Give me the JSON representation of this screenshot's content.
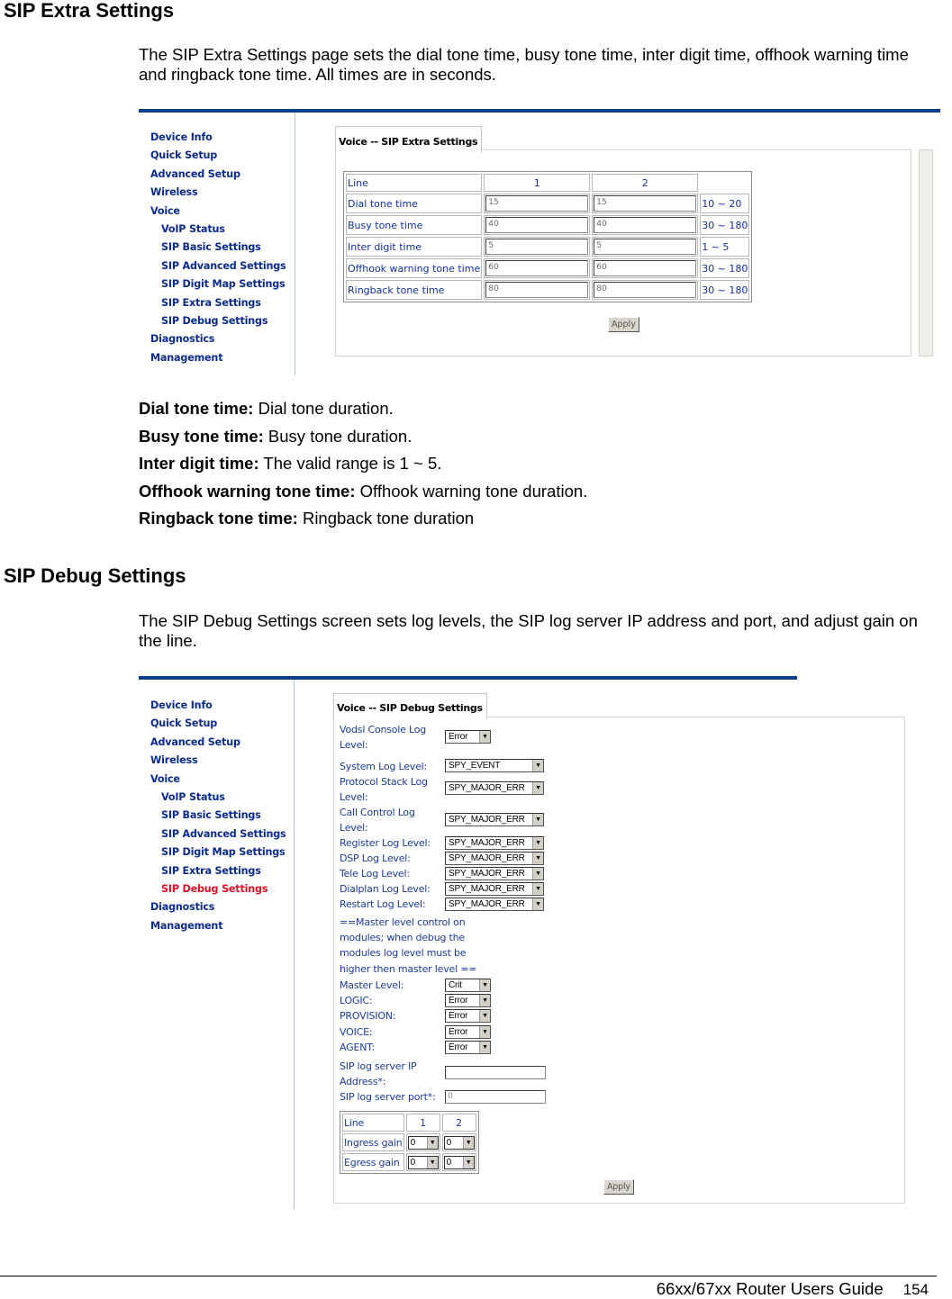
{
  "section1": {
    "heading": "SIP Extra Settings",
    "intro": "The SIP Extra Settings page sets the dial tone time, busy tone time, inter digit time, offhook warning time and ringback tone time. All times are in seconds.",
    "screenshot": {
      "nav": [
        {
          "label": "Device Info",
          "sub": false
        },
        {
          "label": "Quick Setup",
          "sub": false
        },
        {
          "label": "Advanced Setup",
          "sub": false
        },
        {
          "label": "Wireless",
          "sub": false
        },
        {
          "label": "Voice",
          "sub": false
        },
        {
          "label": "VoIP Status",
          "sub": true
        },
        {
          "label": "SIP Basic Settings",
          "sub": true
        },
        {
          "label": "SIP Advanced Settings",
          "sub": true
        },
        {
          "label": "SIP Digit Map Settings",
          "sub": true
        },
        {
          "label": "SIP Extra Settings",
          "sub": true
        },
        {
          "label": "SIP Debug Settings",
          "sub": true
        },
        {
          "label": "Diagnostics",
          "sub": false
        },
        {
          "label": "Management",
          "sub": false
        }
      ],
      "tab_title": "Voice -- SIP Extra Settings",
      "table": {
        "header": [
          "Line",
          "1",
          "2",
          ""
        ],
        "rows": [
          {
            "label": "Dial tone time",
            "line1": "15",
            "line2": "15",
            "range": "10 ~ 20"
          },
          {
            "label": "Busy tone time",
            "line1": "40",
            "line2": "40",
            "range": "30 ~ 180"
          },
          {
            "label": "Inter digit time",
            "line1": "5",
            "line2": "5",
            "range": "1 ~ 5"
          },
          {
            "label": "Offhook warning tone time",
            "line1": "60",
            "line2": "60",
            "range": "30 ~ 180"
          },
          {
            "label": "Ringback tone time",
            "line1": "80",
            "line2": "80",
            "range": "30 ~ 180"
          }
        ]
      },
      "apply_label": "Apply"
    },
    "definitions": [
      {
        "term": "Dial tone time:",
        "desc": " Dial tone duration."
      },
      {
        "term": "Busy tone time:",
        "desc": " Busy tone duration."
      },
      {
        "term": "Inter digit time:",
        "desc": " The valid range is 1 ~ 5."
      },
      {
        "term": "Offhook warning tone time:",
        "desc": " Offhook warning tone duration."
      },
      {
        "term": "Ringback tone time:",
        "desc": " Ringback tone duration"
      }
    ]
  },
  "section2": {
    "heading": "SIP Debug Settings",
    "intro": "The SIP Debug Settings screen sets log levels, the SIP log server IP address and port, and adjust gain on the line.",
    "screenshot": {
      "active_nav": "SIP Debug Settings",
      "tab_title": "Voice -- SIP Debug Settings",
      "log_levels": [
        {
          "label": "Vodsl Console Log Level:",
          "value": "Error"
        },
        {
          "label": "System Log Level:",
          "value": "SPY_EVENT"
        },
        {
          "label": "Protocol Stack Log Level:",
          "value": "SPY_MAJOR_ERR"
        },
        {
          "label": "Call Control Log Level:",
          "value": "SPY_MAJOR_ERR"
        },
        {
          "label": "Register Log Level:",
          "value": "SPY_MAJOR_ERR"
        },
        {
          "label": "DSP Log Level:",
          "value": "SPY_MAJOR_ERR"
        },
        {
          "label": "Tele Log Level:",
          "value": "SPY_MAJOR_ERR"
        },
        {
          "label": "Dialplan Log Level:",
          "value": "SPY_MAJOR_ERR"
        },
        {
          "label": "Restart Log Level:",
          "value": "SPY_MAJOR_ERR"
        }
      ],
      "master_note": [
        "==Master level control on",
        "modules; when debug the",
        "modules log level must be",
        "higher then master level =="
      ],
      "modules": [
        {
          "label": "Master Level:",
          "value": "Crit"
        },
        {
          "label": "LOGIC:",
          "value": "Error"
        },
        {
          "label": "PROVISION:",
          "value": "Error"
        },
        {
          "label": "VOICE:",
          "value": "Error"
        },
        {
          "label": "AGENT:",
          "value": "Error"
        }
      ],
      "server_ip": {
        "label1": "SIP log server IP",
        "label2": "Address*:",
        "value": ""
      },
      "server_port": {
        "label": "SIP log server port*:",
        "value": "0"
      },
      "gain_table": {
        "header": [
          "Line",
          "1",
          "2"
        ],
        "rows": [
          {
            "label": "Ingress gain",
            "line1": "0",
            "line2": "0"
          },
          {
            "label": "Egress gain",
            "line1": "0",
            "line2": "0"
          }
        ]
      },
      "apply_label": "Apply"
    }
  },
  "footer": {
    "guide": "66xx/67xx Router Users Guide",
    "page": "154"
  },
  "colors": {
    "bar": "#0a3f8f",
    "nav": "#0d2b8c",
    "nav_active": "#e0102a",
    "field_label": "#1a3b9c"
  }
}
